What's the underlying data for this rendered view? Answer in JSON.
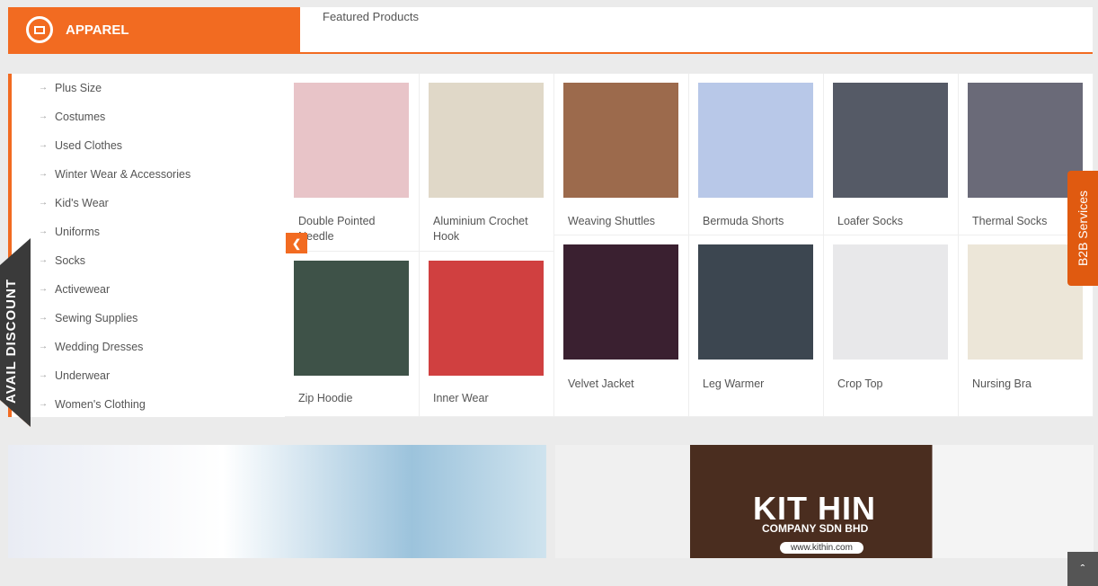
{
  "header": {
    "category": "APPAREL",
    "featured_label": "Featured Products"
  },
  "sidebar": {
    "items": [
      "Plus Size",
      "Costumes",
      "Used Clothes",
      "Winter Wear & Accessories",
      "Kid's Wear",
      "Uniforms",
      "Socks",
      "Activewear",
      "Sewing Supplies",
      "Wedding Dresses",
      "Underwear",
      "Women's Clothing"
    ]
  },
  "products": [
    {
      "name": "Double Pointed Needle",
      "color": "#e8c4c8"
    },
    {
      "name": "Aluminium Crochet Hook",
      "color": "#e0d8c8"
    },
    {
      "name": "Weaving Shuttles",
      "color": "#9c6a4c"
    },
    {
      "name": "Bermuda Shorts",
      "color": "#b8c8e8"
    },
    {
      "name": "Loafer Socks",
      "color": "#555a66"
    },
    {
      "name": "Thermal Socks",
      "color": "#6a6a78"
    },
    {
      "name": "Zip Hoodie",
      "color": "#3e5248"
    },
    {
      "name": "Inner Wear",
      "color": "#d04040"
    },
    {
      "name": "Velvet Jacket",
      "color": "#3a2030"
    },
    {
      "name": "Leg Warmer",
      "color": "#3c4650"
    },
    {
      "name": "Crop Top",
      "color": "#e8e8ea"
    },
    {
      "name": "Nursing Bra",
      "color": "#ece6d8"
    }
  ],
  "floating": {
    "avail_discount": "AVAIL DISCOUNT",
    "b2b_services": "B2B Services"
  },
  "banners": {
    "kithin_title": "KIT HIN",
    "kithin_sub": "COMPANY SDN BHD",
    "kithin_url": "www.kithin.com"
  },
  "colors": {
    "accent": "#f26b21",
    "dark": "#3a3a3a"
  }
}
